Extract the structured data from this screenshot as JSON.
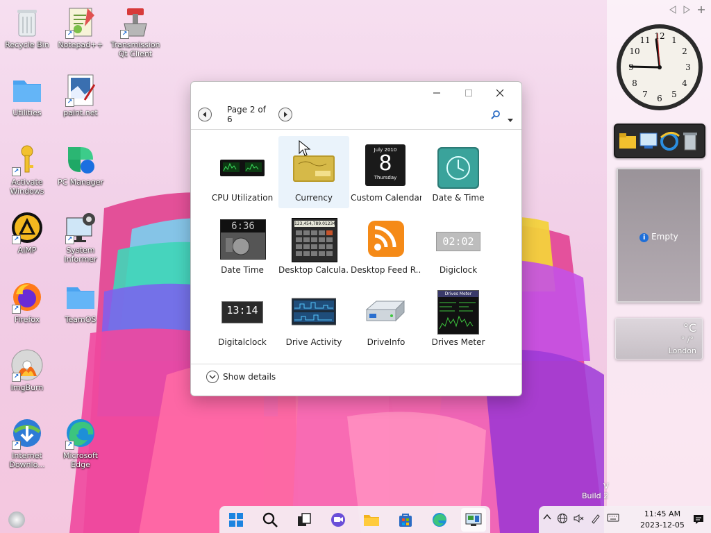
{
  "desktop_icons": [
    {
      "label": "Recycle Bin",
      "icon": "recycle-bin-icon"
    },
    {
      "label": "Notepad++",
      "icon": "notepad-plus-plus-icon"
    },
    {
      "label": "Transmission Qt Client",
      "icon": "transmission-icon"
    },
    {
      "label": "Utilities",
      "icon": "folder-icon"
    },
    {
      "label": "paint.net",
      "icon": "paint-net-icon"
    },
    {
      "label": "Activate Windows",
      "icon": "key-icon"
    },
    {
      "label": "PC Manager",
      "icon": "pc-manager-icon"
    },
    {
      "label": "AIMP",
      "icon": "aimp-icon"
    },
    {
      "label": "System Informer",
      "icon": "system-informer-icon"
    },
    {
      "label": "Firefox",
      "icon": "firefox-icon"
    },
    {
      "label": "TeamOS",
      "icon": "folder-icon"
    },
    {
      "label": "ImgBurn",
      "icon": "imgburn-icon"
    },
    {
      "label": "Internet Downlo...",
      "icon": "internet-download-manager-icon"
    },
    {
      "label": "Microsoft Edge",
      "icon": "edge-icon"
    }
  ],
  "gadget_window": {
    "page_label": "Page 2 of 6",
    "show_details": "Show details",
    "gadgets": [
      "CPU Utilization",
      "Currency",
      "Custom Calendar",
      "Date & Time",
      "Date Time",
      "Desktop Calcula...",
      "Desktop Feed R...",
      "Digiclock",
      "Digitalclock",
      "Drive Activity",
      "DriveInfo",
      "Drives Meter"
    ],
    "selected": "Currency",
    "calendar_month": "July 2010",
    "calendar_day": "8",
    "calendar_weekday": "Thursday",
    "datetime_text": "6:36",
    "calculator_display": "123,454,789.01234",
    "digiclock_time": "02:02",
    "digitalclock_time": "13:14",
    "drives_meter_title": "Drives Meter"
  },
  "sidebar": {
    "empty_label": "Empty",
    "weather_degree": "°C",
    "weather_condition": "° /°",
    "weather_city": "London"
  },
  "watermark": {
    "line1": "V",
    "line2": "Build 2"
  },
  "tray": {
    "time": "11:45 AM",
    "date": "2023-12-05"
  }
}
